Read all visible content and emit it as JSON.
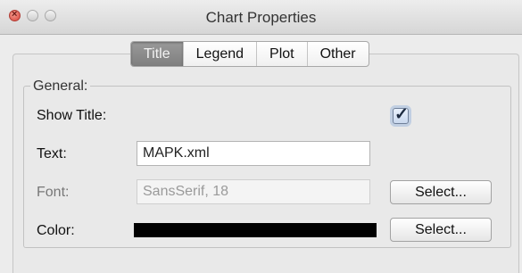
{
  "window": {
    "title": "Chart Properties"
  },
  "tabs": [
    {
      "label": "Title",
      "active": true
    },
    {
      "label": "Legend",
      "active": false
    },
    {
      "label": "Plot",
      "active": false
    },
    {
      "label": "Other",
      "active": false
    }
  ],
  "general": {
    "group_label": "General:",
    "show_title": {
      "label": "Show Title:",
      "checked": true
    },
    "text": {
      "label": "Text:",
      "value": "MAPK.xml"
    },
    "font": {
      "label": "Font:",
      "value": "SansSerif, 18",
      "button": "Select..."
    },
    "color": {
      "label": "Color:",
      "value": "#000000",
      "button": "Select..."
    }
  }
}
